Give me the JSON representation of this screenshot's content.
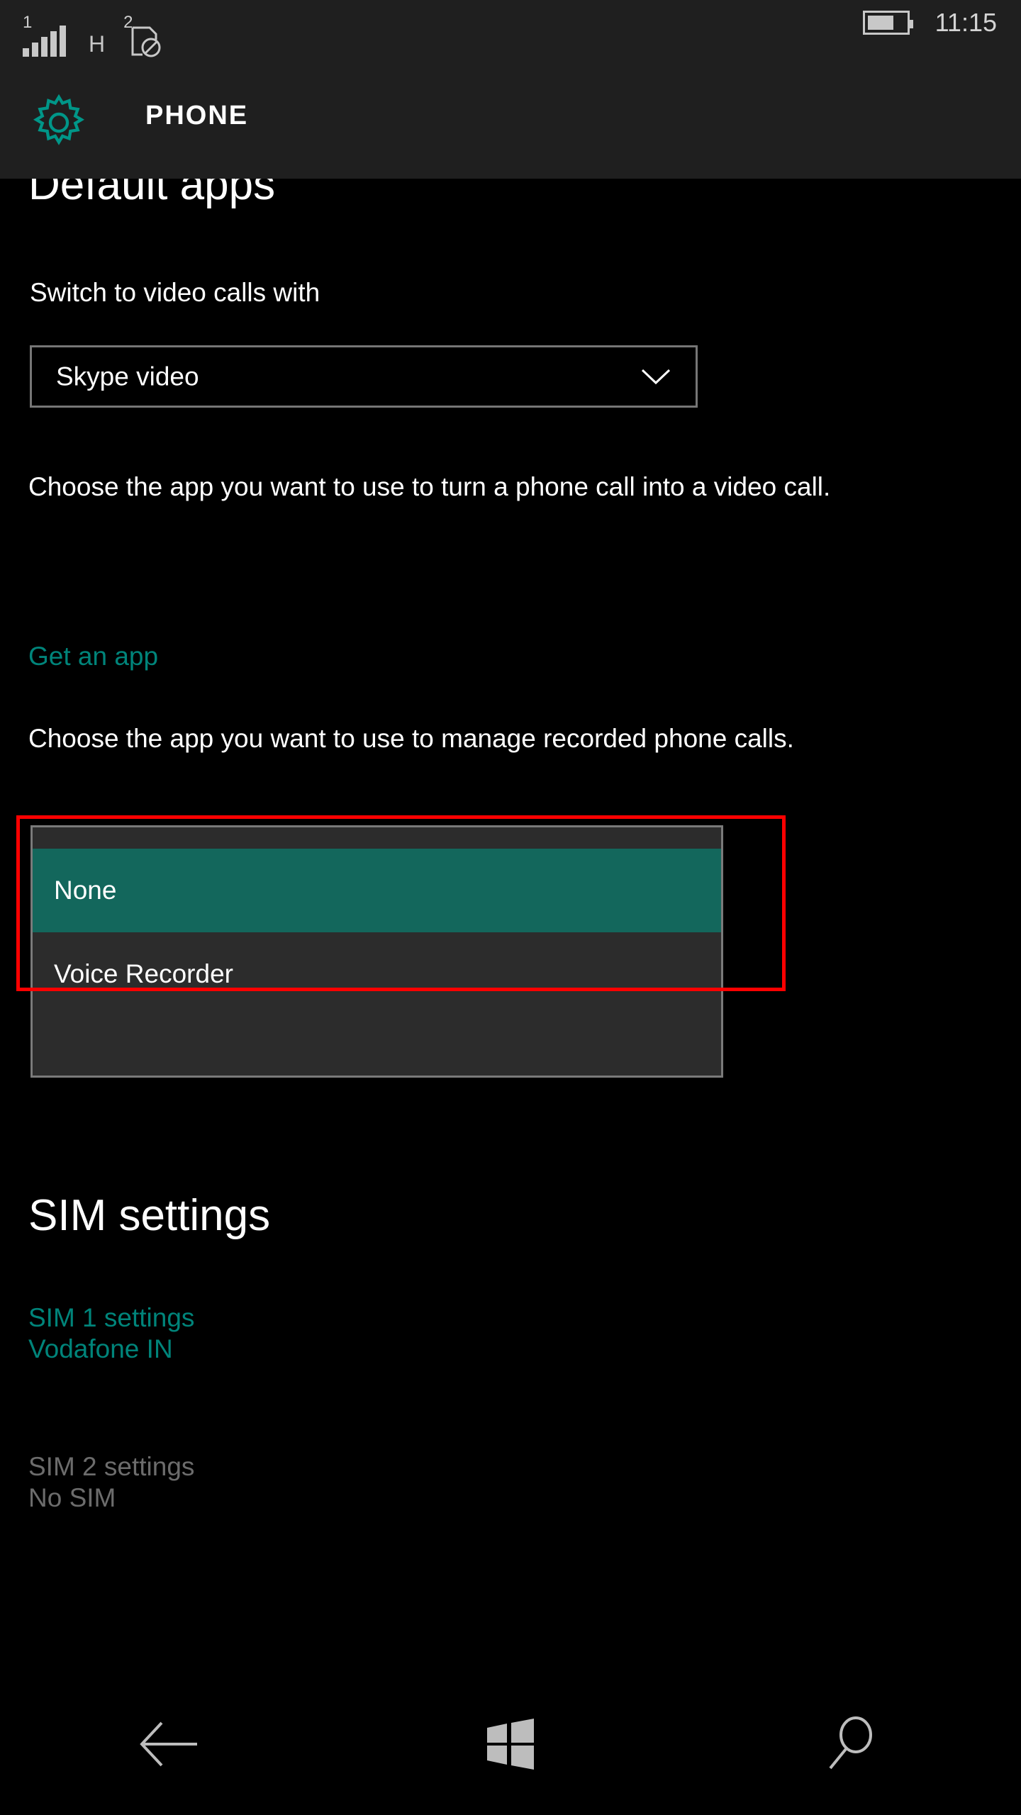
{
  "status_bar": {
    "signal_sim_label": "1",
    "signal_icon": "signal-bars-icon",
    "signal_bars_filled": 5,
    "network_type": "H",
    "sim2_label": "2",
    "sim2_icon": "sim-card-disabled-icon",
    "battery_icon": "battery-icon",
    "battery_level_percent": 60,
    "time": "11:15"
  },
  "header": {
    "icon": "gear-icon",
    "icon_color": "#009688",
    "title": "PHONE"
  },
  "page": {
    "title": "Default apps",
    "video_call": {
      "label": "Switch to video calls with",
      "selected_value": "Skype video",
      "chevron_icon": "chevron-down-icon",
      "description": "Choose the app you want to use to turn a phone call into a video call.",
      "get_app_link": "Get an app"
    },
    "call_recording": {
      "description": "Choose the app you want to use to manage recorded phone calls.",
      "dropdown_open": true,
      "options": [
        {
          "label": "None",
          "selected": true
        },
        {
          "label": "Voice Recorder",
          "selected": false
        }
      ]
    },
    "sim_section": {
      "title": "SIM settings",
      "entries": [
        {
          "name": "SIM 1 settings",
          "status": "Vodafone IN",
          "enabled": true
        },
        {
          "name": "SIM 2 settings",
          "status": "No SIM",
          "enabled": false
        }
      ]
    }
  },
  "nav_bar": {
    "back_icon": "back-arrow-icon",
    "home_icon": "windows-logo-icon",
    "search_icon": "search-icon"
  },
  "colors": {
    "accent_teal": "#00847a",
    "highlight_teal": "#13675c",
    "annotation_red": "#fe0000",
    "chrome": "#1f1f1f",
    "popup_bg": "#2c2c2c",
    "disabled_gray": "#6c6c6c"
  }
}
